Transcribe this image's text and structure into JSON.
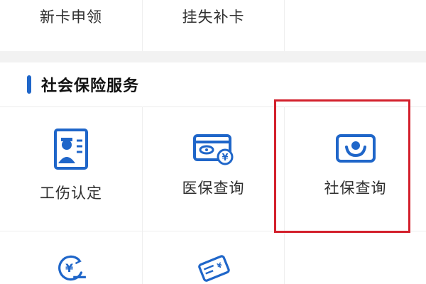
{
  "top_row": {
    "items": [
      {
        "label": "新卡申领",
        "icon": "new-card-icon"
      },
      {
        "label": "挂失补卡",
        "icon": "report-loss-icon"
      },
      {
        "label": "",
        "icon": ""
      }
    ]
  },
  "section": {
    "title": "社会保险服务",
    "accent_color": "#1f66c9"
  },
  "services": [
    {
      "label": "工伤认定",
      "icon": "work-injury-icon"
    },
    {
      "label": "医保查询",
      "icon": "medical-card-icon"
    },
    {
      "label": "社保查询",
      "icon": "social-security-icon",
      "highlighted": true
    },
    {
      "label": "",
      "icon": "yuan-refresh-icon"
    },
    {
      "label": "",
      "icon": "card-edit-icon"
    },
    {
      "label": "",
      "icon": ""
    }
  ],
  "colors": {
    "icon_blue": "#1f66c9",
    "highlight_red": "#d3202c",
    "separator_gray": "#f2f2f2"
  }
}
